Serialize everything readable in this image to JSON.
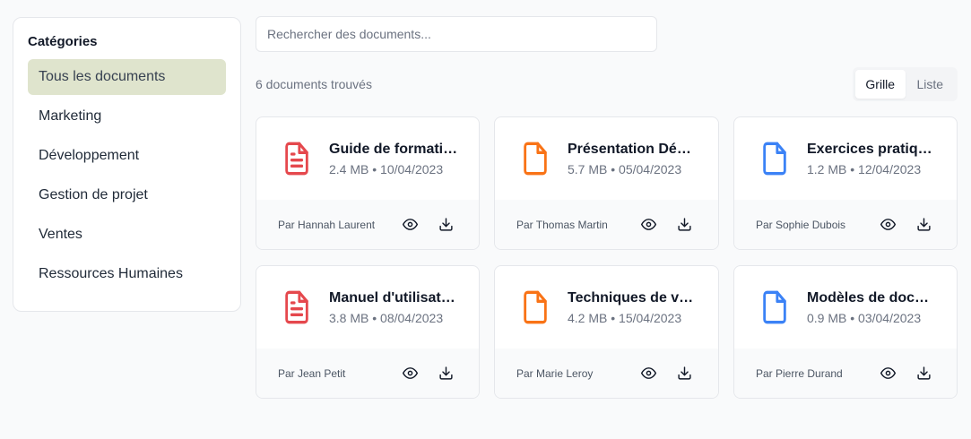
{
  "sidebar": {
    "title": "Catégories",
    "items": [
      {
        "label": "Tous les documents",
        "active": true
      },
      {
        "label": "Marketing",
        "active": false
      },
      {
        "label": "Développement",
        "active": false
      },
      {
        "label": "Gestion de projet",
        "active": false
      },
      {
        "label": "Ventes",
        "active": false
      },
      {
        "label": "Ressources Humaines",
        "active": false
      }
    ]
  },
  "search": {
    "placeholder": "Rechercher des documents...",
    "value": ""
  },
  "results": {
    "count_label": "6 documents trouvés"
  },
  "view_toggle": {
    "grid_label": "Grille",
    "list_label": "Liste",
    "selected": "Grille"
  },
  "colors": {
    "active_category_bg": "#dfe4cd",
    "pdf_icon": "#ef4444",
    "ppt_icon": "#f97316",
    "doc_icon": "#3b82f6"
  },
  "documents": [
    {
      "title": "Guide de formati…",
      "size": "2.4 MB",
      "date": "10/04/2023",
      "author": "Par Hannah Laurent",
      "icon": "file-text-icon",
      "color": "#e5484d"
    },
    {
      "title": "Présentation Dé…",
      "size": "5.7 MB",
      "date": "05/04/2023",
      "author": "Par Thomas Martin",
      "icon": "file-icon",
      "color": "#f97316"
    },
    {
      "title": "Exercices pratiq…",
      "size": "1.2 MB",
      "date": "12/04/2023",
      "author": "Par Sophie Dubois",
      "icon": "file-icon",
      "color": "#3b82f6"
    },
    {
      "title": "Manuel d'utilisat…",
      "size": "3.8 MB",
      "date": "08/04/2023",
      "author": "Par Jean Petit",
      "icon": "file-text-icon",
      "color": "#e5484d"
    },
    {
      "title": "Techniques de v…",
      "size": "4.2 MB",
      "date": "15/04/2023",
      "author": "Par Marie Leroy",
      "icon": "file-icon",
      "color": "#f97316"
    },
    {
      "title": "Modèles de doc…",
      "size": "0.9 MB",
      "date": "03/04/2023",
      "author": "Par Pierre Durand",
      "icon": "file-icon",
      "color": "#3b82f6"
    }
  ]
}
